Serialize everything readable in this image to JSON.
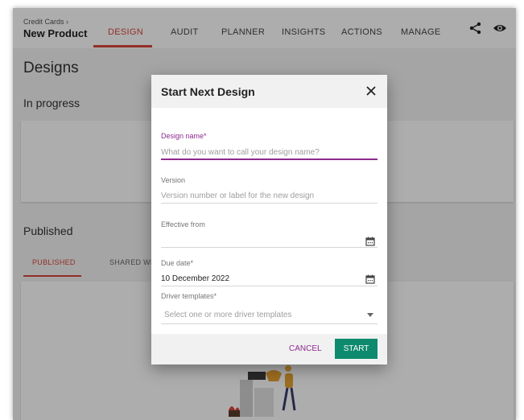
{
  "header": {
    "breadcrumb": "Credit Cards ›",
    "product": "New Product",
    "tabs": [
      {
        "label": "DESIGN"
      },
      {
        "label": "AUDIT"
      },
      {
        "label": "PLANNER"
      },
      {
        "label": "INSIGHTS"
      },
      {
        "label": "ACTIONS"
      },
      {
        "label": "MANAGE"
      }
    ],
    "icons": [
      "share-icon",
      "eye-icon"
    ]
  },
  "page": {
    "title": "Designs",
    "in_progress_title": "In progress",
    "published_title": "Published",
    "published_tabs": [
      {
        "label": "PUBLISHED"
      },
      {
        "label": "SHARED WIT"
      }
    ]
  },
  "dialog": {
    "title": "Start Next Design",
    "fields": {
      "design_name": {
        "label": "Design name*",
        "value": "",
        "placeholder": "What do you want to call your design name?"
      },
      "version": {
        "label": "Version",
        "value": "",
        "placeholder": "Version number or label for the new design"
      },
      "effective_from": {
        "label": "Effective from",
        "value": "",
        "placeholder": ""
      },
      "due_date": {
        "label": "Due date*",
        "value": "10 December 2022",
        "placeholder": ""
      },
      "driver_templates": {
        "label": "Driver templates*",
        "value": "",
        "placeholder": "Select one or more driver templates"
      }
    },
    "cancel_label": "CANCEL",
    "start_label": "START"
  },
  "colors": {
    "accent_red": "#d9463a",
    "focus_purple": "#8e2a8e",
    "start_green": "#0e8a6e"
  }
}
